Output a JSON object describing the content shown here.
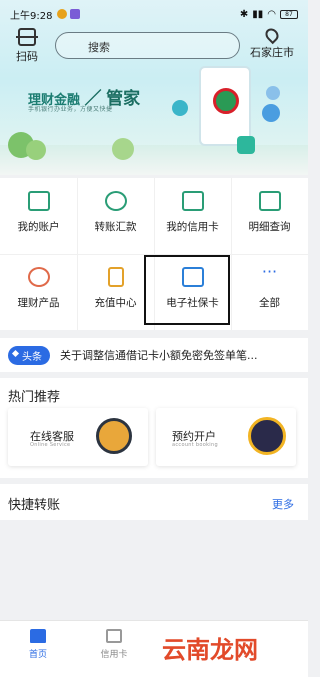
{
  "status": {
    "time": "上午9:28",
    "battery": "87"
  },
  "header": {
    "scan_label": "扫码",
    "search_placeholder": "搜索",
    "city": "石家庄市"
  },
  "banner": {
    "title_left": "理财金融",
    "title_right": "管家",
    "subtitle": "手机银行办业务，方便又快捷"
  },
  "functions": [
    {
      "label": "我的账户",
      "icon": "account-card-icon"
    },
    {
      "label": "转账汇款",
      "icon": "transfer-coin-icon"
    },
    {
      "label": "我的信用卡",
      "icon": "credit-card-icon"
    },
    {
      "label": "明细查询",
      "icon": "detail-list-icon"
    },
    {
      "label": "理财产品",
      "icon": "finance-chart-icon"
    },
    {
      "label": "充值中心",
      "icon": "phone-recharge-icon"
    },
    {
      "label": "电子社保卡",
      "icon": "social-security-card-icon"
    },
    {
      "label": "全部",
      "icon": "more-dots-icon"
    }
  ],
  "news": {
    "tag": "头条",
    "text": "关于调整信通借记卡小额免密免签单笔..."
  },
  "hot": {
    "title": "热门推荐",
    "cards": [
      {
        "title": "在线客服",
        "subtitle": "Online Service"
      },
      {
        "title": "预约开户",
        "subtitle": "account booking"
      }
    ]
  },
  "quick": {
    "title": "快捷转账",
    "more": "更多"
  },
  "nav": {
    "items": [
      "首页",
      "信用卡"
    ]
  },
  "watermark": "云南龙网",
  "colors": {
    "accent": "#2b6be3",
    "green": "#2a9d76"
  }
}
